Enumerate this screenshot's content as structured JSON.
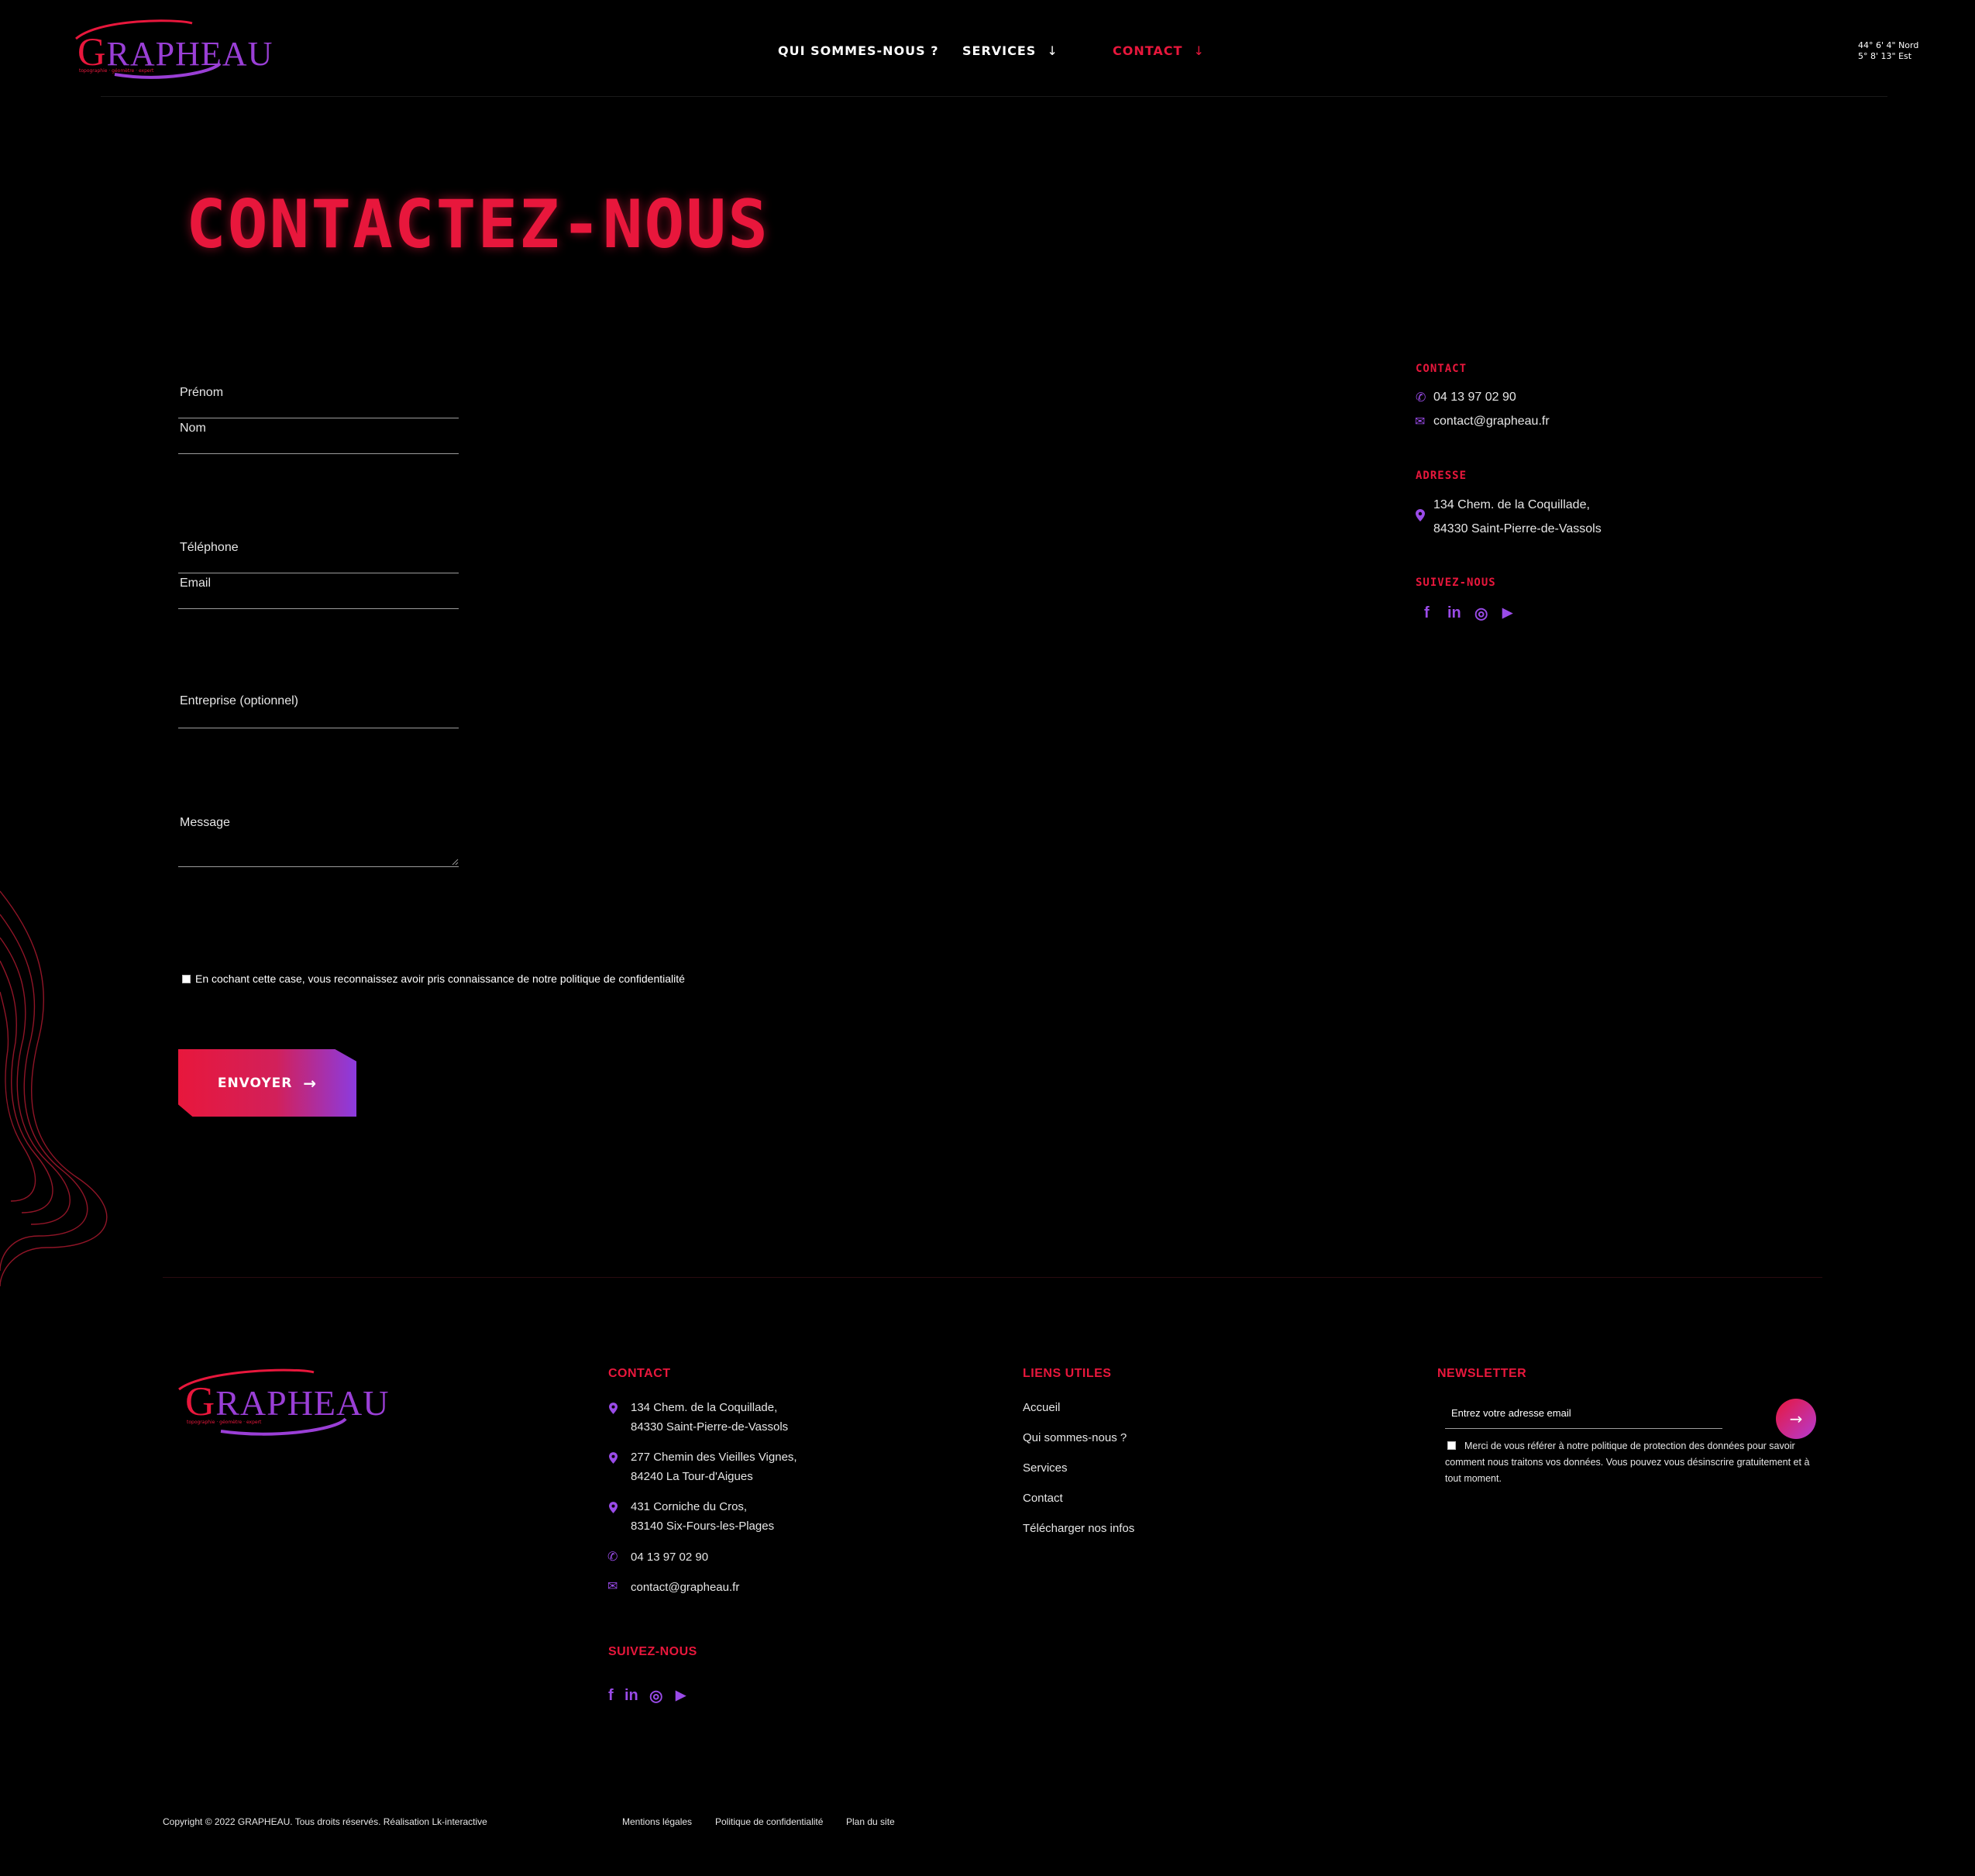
{
  "header": {
    "logo_text": "GRAPHEAU",
    "logo_tagline": "topographie · géomètre · expert",
    "nav": [
      {
        "label": "QUI SOMMES-NOUS ?"
      },
      {
        "label": "SERVICES",
        "arrow": "↓"
      },
      {
        "label": "CONTACT",
        "arrow": "↓"
      }
    ],
    "coords_line1": "44° 6' 4\" Nord",
    "coords_line2": "5° 8' 13\" Est"
  },
  "page_title": "CONTACTEZ-NOUS",
  "form": {
    "prenom": "Prénom",
    "nom": "Nom",
    "telephone": "Téléphone",
    "email": "Email",
    "entreprise": "Entreprise (optionnel)",
    "message": "Message",
    "consent": "En cochant cette case, vous reconnaissez avoir pris connaissance de notre politique de confidentialité",
    "submit": "ENVOYER",
    "submit_icon": "→"
  },
  "sidebar": {
    "contact_heading": "CONTACT",
    "phone": "04 13 97 02 90",
    "email": "contact@grapheau.fr",
    "address_heading": "ADRESSE",
    "address_line1": "134 Chem. de la Coquillade,",
    "address_line2": "84330 Saint-Pierre-de-Vassols",
    "follow_heading": "SUIVEZ-NOUS",
    "social": [
      "f",
      "in",
      "◎",
      "▶"
    ]
  },
  "footer": {
    "logo_text": "GRAPHEAU",
    "logo_tagline": "topographie · géomètre · expert",
    "contact_heading": "CONTACT",
    "addresses": [
      {
        "line1": "134 Chem. de la Coquillade,",
        "line2": "84330 Saint-Pierre-de-Vassols"
      },
      {
        "line1": "277 Chemin des Vieilles Vignes,",
        "line2": "84240 La Tour-d'Aigues"
      },
      {
        "line1": "431 Corniche du Cros,",
        "line2": "83140 Six-Fours-les-Plages"
      }
    ],
    "phone": "04 13 97 02 90",
    "email": "contact@grapheau.fr",
    "follow_heading": "SUIVEZ-NOUS",
    "social": [
      "f",
      "in",
      "◎",
      "▶"
    ],
    "links_heading": "LIENS UTILES",
    "links": [
      "Accueil",
      "Qui sommes-nous ?",
      "Services",
      "Contact",
      "Télécharger nos infos"
    ],
    "newsletter_heading": "NEWSLETTER",
    "newsletter_placeholder": "Entrez votre adresse email",
    "newsletter_icon": "→",
    "newsletter_consent": "Merci de vous référer à notre politique de protection des données pour savoir comment nous traitons vos données. Vous pouvez vous désinscrire gratuitement et à tout moment."
  },
  "bottom": {
    "copyright": "Copyright © 2022 GRAPHEAU. Tous droits réservés. Réalisation Lk-interactive",
    "legal": "Mentions légales",
    "privacy": "Politique de confidentialité",
    "sitemap": "Plan du site"
  },
  "colors": {
    "accent": "#e8173c",
    "purple": "#9a4be8",
    "bg": "#000000"
  }
}
